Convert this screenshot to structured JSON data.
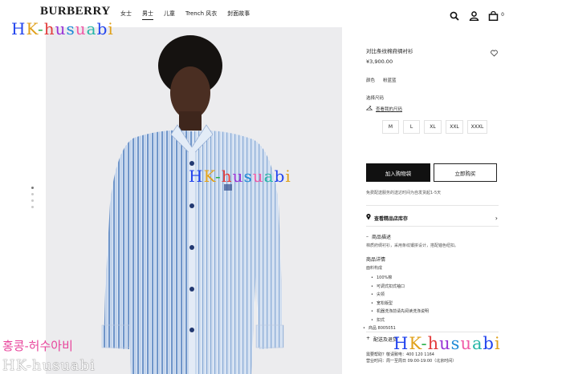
{
  "header": {
    "logo": "BURBERRY",
    "nav": [
      "女士",
      "男士",
      "儿童",
      "Trench 风衣",
      "封面故事"
    ],
    "active_nav_index": 1,
    "bag_count": "0",
    "icons": [
      "search-icon",
      "account-icon",
      "bag-icon"
    ]
  },
  "product": {
    "title": "对比条纹棉府绸衬衫",
    "price": "¥3,900.00",
    "color_label": "颜色",
    "color_value": "粉蓝蓝",
    "size_label": "选择尺码",
    "size_guide": "查看我的尺码",
    "sizes": [
      "M",
      "L",
      "XL",
      "XXL",
      "XXXL"
    ],
    "add_to_bag": "加入购物袋",
    "buy_now": "立即购买",
    "shipping_note": "免费配送服务的送达时间为自发货起1-5天",
    "store_link": "查看精品店库存",
    "description_heading": "商品描述",
    "description": "棉质府绸衬衫，采用条纹镶拼设计，搭配锚色纽扣。",
    "details_heading": "商品详情",
    "fabric_heading": "面料构成",
    "features": [
      "100%棉",
      "可调式扣式袖口",
      "尖领",
      "宽松版型",
      "机器洗涤前请先阅读洗涤说明",
      "扣式"
    ],
    "item_number": "商品 8005051",
    "shipping_heading": "配送及退货",
    "contact_lines": [
      "需要帮助？敬请致电：400 120 1164",
      "营业时间：周一至周日 09:00-19:00（北京时间）"
    ]
  },
  "gallery": {
    "dot_count": 4,
    "active_dot": 0
  },
  "watermarks": {
    "top_left": "HK-husuabi",
    "middle": "HK-husuabi",
    "bottom_right": "HK-husuabi",
    "korean": "홍콩-허수아비",
    "bottom_left": "HK-husuabi"
  }
}
